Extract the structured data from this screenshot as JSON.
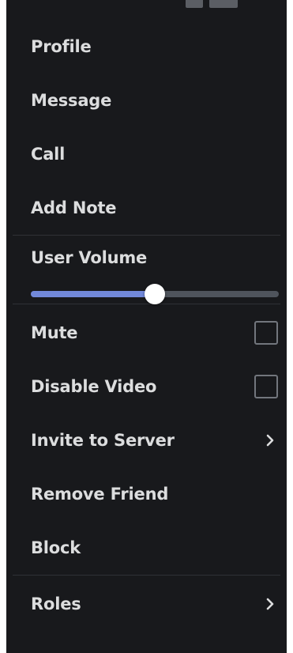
{
  "colors": {
    "menu_background": "#18191c",
    "text": "#dcddde",
    "separator": "#2f3136",
    "slider_fill": "#7289da",
    "slider_track": "#4f545c",
    "checkbox_border": "#72767d"
  },
  "group1": {
    "profile": "Profile",
    "message": "Message",
    "call": "Call",
    "add_note": "Add Note"
  },
  "volume": {
    "label": "User Volume",
    "value_fraction": 0.5
  },
  "group3": {
    "mute": {
      "label": "Mute",
      "checked": false
    },
    "disable_video": {
      "label": "Disable Video",
      "checked": false
    },
    "invite": {
      "label": "Invite to Server",
      "icon": "chevron-right-icon"
    },
    "remove_friend": "Remove Friend",
    "block": "Block"
  },
  "group4": {
    "roles": {
      "label": "Roles",
      "icon": "chevron-right-icon"
    }
  }
}
